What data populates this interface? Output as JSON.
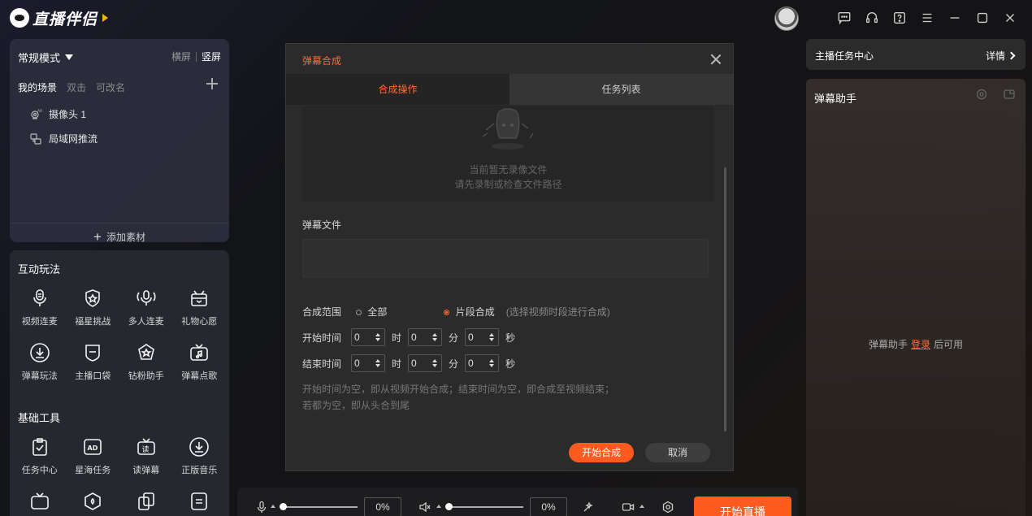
{
  "app": {
    "logo_text": "直播伴侣"
  },
  "scene_panel": {
    "mode_label": "常规模式",
    "orientation": {
      "landscape": "横屏",
      "portrait": "竖屏"
    },
    "tabs": {
      "my_scenes": "我的场景",
      "double_click": "双击",
      "renamable": "可改名"
    },
    "sources": [
      {
        "label": "摄像头 1",
        "icon": "camera-ar-icon"
      },
      {
        "label": "局域网推流",
        "icon": "lan-stream-icon"
      }
    ],
    "add_material": "添加素材"
  },
  "interactive": {
    "title": "互动玩法",
    "tools": [
      {
        "label": "视频连麦",
        "icon": "mic-icon"
      },
      {
        "label": "福星挑战",
        "icon": "shield-star-icon"
      },
      {
        "label": "多人连麦",
        "icon": "multi-mic-icon"
      },
      {
        "label": "礼物心愿",
        "icon": "gift-icon"
      },
      {
        "label": "弹幕玩法",
        "icon": "download-circle-icon"
      },
      {
        "label": "主播口袋",
        "icon": "pocket-icon"
      },
      {
        "label": "钻粉助手",
        "icon": "diamond-icon"
      },
      {
        "label": "弹幕点歌",
        "icon": "tv-music-icon"
      }
    ]
  },
  "basic_tools": {
    "title": "基础工具",
    "tools": [
      {
        "label": "任务中心",
        "icon": "clipboard-check-icon"
      },
      {
        "label": "星海任务",
        "icon": "ad-icon"
      },
      {
        "label": "读弹幕",
        "icon": "read-danmu-icon"
      },
      {
        "label": "正版音乐",
        "icon": "download-circle-icon"
      }
    ]
  },
  "task_center": {
    "label": "主播任务中心",
    "detail": "详情"
  },
  "danmu_assistant": {
    "title": "弹幕助手",
    "msg_prefix": "弹幕助手",
    "login": "登录",
    "msg_suffix": "后可用"
  },
  "bottom_bar": {
    "mic_percent": "0%",
    "speaker_percent": "0%",
    "mic_level": 0,
    "speaker_level": 0,
    "go_live": "开始直播"
  },
  "modal": {
    "title": "弹幕合成",
    "tabs": {
      "compose": "合成操作",
      "task_list": "任务列表"
    },
    "empty_line1": "当前暂无录像文件",
    "empty_line2": "请先录制或检查文件路径",
    "file_label": "弹幕文件",
    "range_label": "合成范围",
    "range_all": "全部",
    "range_segment": "片段合成",
    "range_hint": "(选择视频时段进行合成)",
    "start_label": "开始时间",
    "end_label": "结束时间",
    "start": {
      "h": "0",
      "m": "0",
      "s": "0"
    },
    "end": {
      "h": "0",
      "m": "0",
      "s": "0"
    },
    "unit_h": "时",
    "unit_m": "分",
    "unit_s": "秒",
    "note1": "开始时间为空，即从视频开始合成；结束时间为空，即合成至视频结束；",
    "note2": "若都为空，即从头合到尾",
    "btn_start": "开始合成",
    "btn_cancel": "取消"
  },
  "colors": {
    "accent": "#ff5a1f",
    "accent_text": "#ff6a33",
    "panel": "#2a2c36"
  }
}
